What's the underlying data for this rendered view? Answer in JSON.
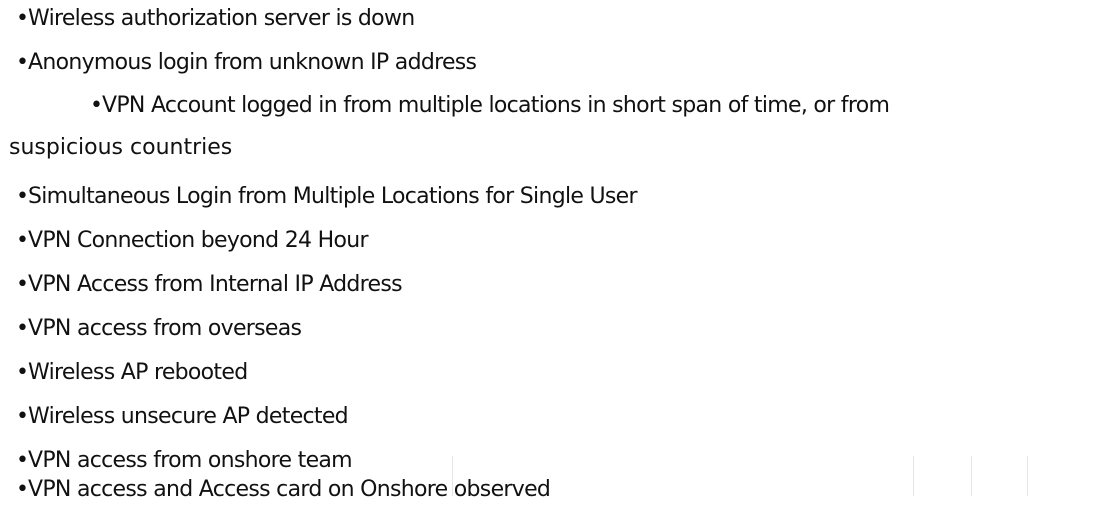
{
  "bullet_symbol": "•",
  "items": [
    {
      "text": "Wireless authorization server is down"
    },
    {
      "text": "Anonymous login from unknown IP address"
    },
    {
      "text": "VPN Account logged in from multiple locations in short span of time, or from"
    },
    {
      "text": "suspicious countries"
    },
    {
      "text": "Simultaneous Login from Multiple Locations for Single User"
    },
    {
      "text": "VPN Connection beyond 24 Hour"
    },
    {
      "text": "VPN Access from Internal IP Address"
    },
    {
      "text": "VPN access from overseas"
    },
    {
      "text": "Wireless AP rebooted"
    },
    {
      "text": "Wireless unsecure AP detected"
    },
    {
      "text": "VPN access from onshore team"
    },
    {
      "text": "VPN access and Access card on Onshore observed"
    }
  ]
}
